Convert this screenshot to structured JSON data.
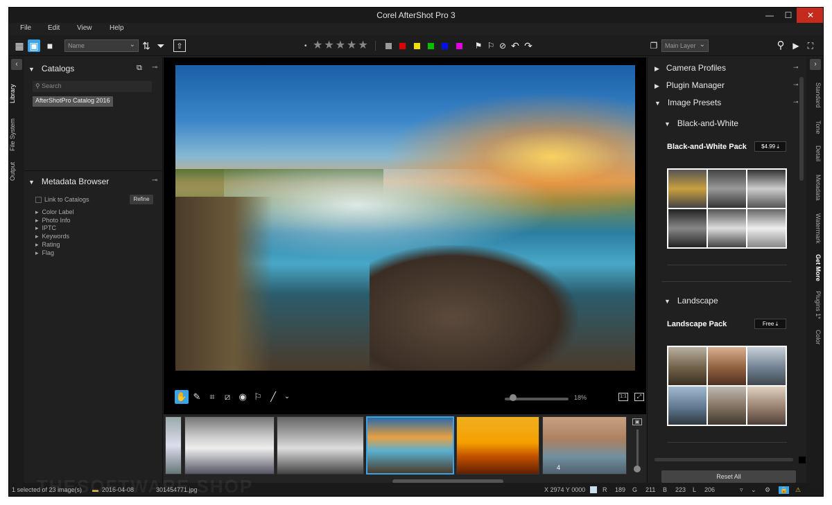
{
  "window": {
    "title": "Corel AfterShot Pro 3"
  },
  "menu": [
    "File",
    "Edit",
    "View",
    "Help"
  ],
  "toolbar": {
    "sort_select": "Name",
    "layer_select": "Main Layer",
    "stars": "★★★★★",
    "color_swatches": [
      "#9a9a9a",
      "#e00000",
      "#f0e000",
      "#00c000",
      "#0010f0",
      "#e000e0"
    ]
  },
  "left_tabs": [
    "Library",
    "File System",
    "Output"
  ],
  "catalogs": {
    "header": "Catalogs",
    "search_placeholder": "Search",
    "items": [
      "AfterShotPro Catalog 2016"
    ]
  },
  "metadata": {
    "header": "Metadata Browser",
    "link_label": "Link to Catalogs",
    "refine_label": "Refine",
    "items": [
      "Color Label",
      "Photo Info",
      "IPTC",
      "Keywords",
      "Rating",
      "Flag"
    ]
  },
  "viewer": {
    "zoom_label": "18%",
    "zoom_value_percent": 18,
    "one_to_one": "1:1"
  },
  "filmstrip": {
    "thumbs": [
      "white-horses-1",
      "white-horses-2",
      "waterfall-sunset",
      "horses-sunset",
      "horse-beach"
    ],
    "selected_index": 2,
    "badge": "4"
  },
  "right_panel": {
    "sections": [
      "Camera Profiles",
      "Plugin Manager",
      "Image Presets"
    ],
    "subsections": [
      {
        "title": "Black-and-White",
        "pack": "Black-and-White Pack",
        "price": "$4.99"
      },
      {
        "title": "Landscape",
        "pack": "Landscape Pack",
        "price": "Free"
      }
    ],
    "reset_label": "Reset All"
  },
  "right_tabs": [
    "Standard",
    "Tone",
    "Detail",
    "Metadata",
    "Watermark",
    "Get More",
    "Plugins 1*",
    "Color"
  ],
  "status": {
    "selection": "1 selected of 23 image(s)",
    "date": "2016-04-08",
    "file": "301454771.jpg",
    "coords": "X 2974  Y 0000",
    "r_label": "R",
    "r_value": "189",
    "g_label": "G",
    "g_value": "211",
    "b_label": "B",
    "b_value": "223",
    "l_label": "L",
    "l_value": "206"
  },
  "watermark": "THESOFTWARE.SHOP"
}
